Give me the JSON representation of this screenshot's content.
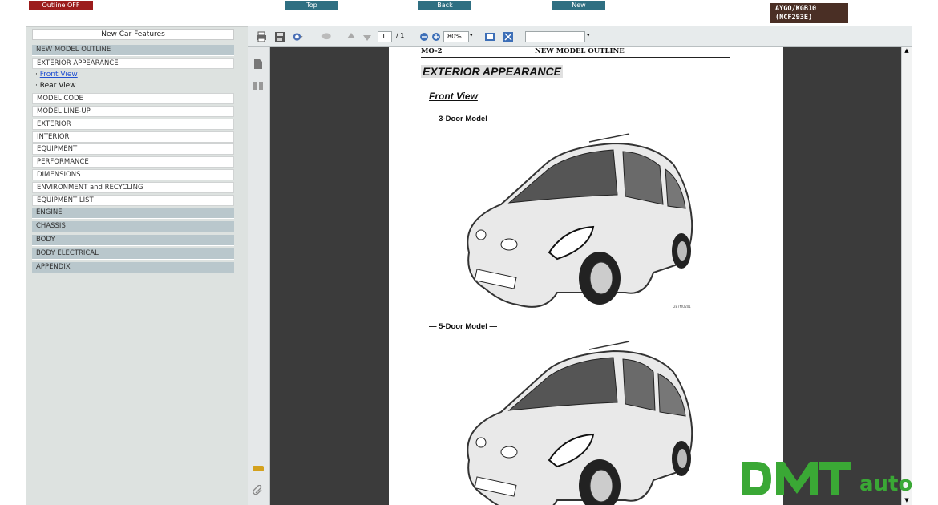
{
  "topbar": {
    "outline_btn": "Outline OFF",
    "top_btn": "Top",
    "back_btn": "Back",
    "new_btn": "New",
    "model_line1": "AYGO/KGB10",
    "model_line2": "(NCF293E)"
  },
  "sidebar": {
    "header": "New Car Features",
    "item_new_model": "NEW MODEL OUTLINE",
    "item_exterior_appearance": "EXTERIOR APPEARANCE",
    "link_front": "Front View",
    "link_rear": "Rear View",
    "sub_items": [
      "MODEL CODE",
      "MODEL LINE-UP",
      "EXTERIOR",
      "INTERIOR",
      "EQUIPMENT",
      "PERFORMANCE",
      "DIMENSIONS",
      "ENVIRONMENT and RECYCLING",
      "EQUIPMENT LIST"
    ],
    "top_items": [
      "ENGINE",
      "CHASSIS",
      "BODY",
      "BODY ELECTRICAL",
      "APPENDIX"
    ]
  },
  "toolbar": {
    "page_current": "1",
    "page_total": "/ 1",
    "zoom": "80%"
  },
  "page": {
    "header_left": "MO-2",
    "header_center": "NEW MODEL OUTLINE",
    "section_title": "EXTERIOR APPEARANCE",
    "subtitle": "Front View",
    "model_3door": "— 3-Door Model —",
    "model_5door": "— 5-Door Model —",
    "figure_id": "2E7MO201"
  },
  "watermark": {
    "logo_word": "auto"
  },
  "colors": {
    "outline_btn": "#9c1c1c",
    "nav_btn": "#2f6f82",
    "model_box": "#4a2f25",
    "sidebar_top_item": "#b9c7cc",
    "watermark_green": "#3aa835"
  }
}
